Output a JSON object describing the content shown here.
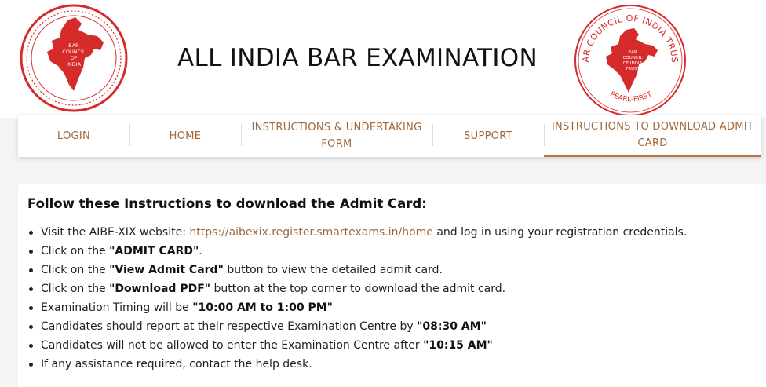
{
  "header": {
    "title": "ALL INDIA BAR EXAMINATION",
    "logo_left": {
      "text_lines": [
        "BAR",
        "COUNCIL",
        "OF",
        "INDIA"
      ],
      "color": "#d52b2b"
    },
    "logo_right": {
      "arc_top": "BAR COUNCIL OF INDIA TRUST",
      "text_lines": [
        "BAR",
        "COUNCIL",
        "OF INDIA",
        "TRUST"
      ],
      "arc_bottom": "PEARL-FIRST",
      "color": "#d52b2b"
    }
  },
  "nav": {
    "items": [
      {
        "label": "LOGIN",
        "active": false
      },
      {
        "label": "HOME",
        "active": false
      },
      {
        "label": "INSTRUCTIONS & UNDERTAKING FORM",
        "line1": "INSTRUCTIONS & UNDERTAKING",
        "line2": "FORM",
        "active": false
      },
      {
        "label": "SUPPORT",
        "active": false
      },
      {
        "label": "INSTRUCTIONS TO DOWNLOAD ADMIT CARD",
        "line1": "INSTRUCTIONS TO DOWNLOAD ADMIT",
        "line2": "CARD",
        "active": true
      }
    ],
    "accent_color": "#a0683a"
  },
  "instructions": {
    "heading": "Follow these Instructions to download the Admit Card:",
    "items": [
      {
        "pre": "Visit the AIBE-XIX website: ",
        "link": "https://aibexix.register.smartexams.in/home",
        "post": " and log in using your registration credentials."
      },
      {
        "pre": "Click on the ",
        "bold": "\"ADMIT CARD\"",
        "post": "."
      },
      {
        "pre": "Click on the ",
        "bold": "\"View Admit Card\"",
        "post": " button to view the detailed admit card."
      },
      {
        "pre": "Click on the ",
        "bold": "\"Download PDF\"",
        "post": " button at the top corner to download the admit card."
      },
      {
        "pre": "Examination Timing will be ",
        "bold": "\"10:00 AM to 1:00 PM\"",
        "post": ""
      },
      {
        "pre": "Candidates should report at their respective Examination Centre by ",
        "bold": "\"08:30 AM\"",
        "post": ""
      },
      {
        "pre": "Candidates will not be allowed to enter the Examination Centre after ",
        "bold": "\"10:15 AM\"",
        "post": ""
      },
      {
        "pre": "If any assistance required, contact the help desk.",
        "post": ""
      }
    ]
  }
}
